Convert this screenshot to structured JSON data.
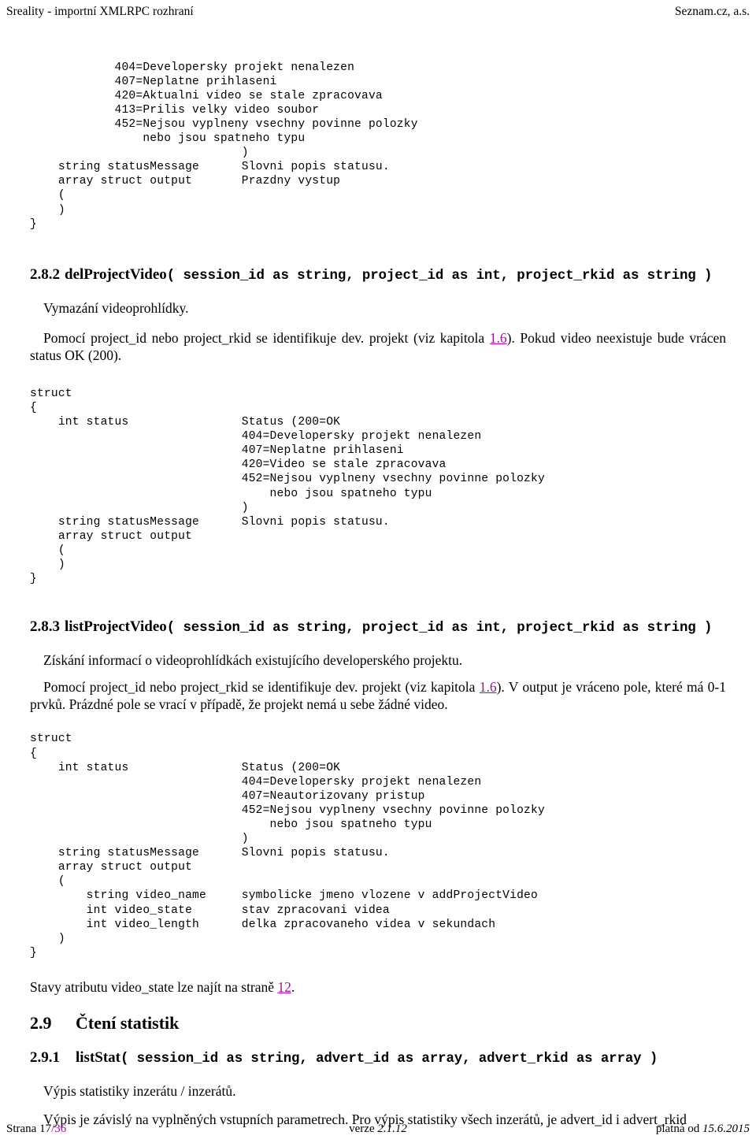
{
  "header": {
    "left": "Sreality - importní XMLRPC rozhraní",
    "right": "Seznam.cz, a.s."
  },
  "footer": {
    "page_label": "Strana ",
    "page_current": "17",
    "page_total": "/36",
    "version_label": "verze ",
    "version_value": "2.1.12",
    "valid_label": "platná od ",
    "valid_value": "15.6.2015"
  },
  "blocks": {
    "top_struct_tail": "            404=Developersky projekt nenalezen\n            407=Neplatne prihlaseni\n            420=Aktualni video se stale zpracovava\n            413=Prilis velky video soubor\n            452=Nejsou vyplneny vsechny povinne polozky\n                nebo jsou spatneho typu\n                              )\n    string statusMessage      Slovni popis statusu.\n    array struct output       Prazdny vystup\n    (\n    )\n}",
    "del_struct": "struct\n{\n    int status                Status (200=OK\n                              404=Developersky projekt nenalezen\n                              407=Neplatne prihlaseni\n                              420=Video se stale zpracovava\n                              452=Nejsou vyplneny vsechny povinne polozky\n                                  nebo jsou spatneho typu\n                              )\n    string statusMessage      Slovni popis statusu.\n    array struct output\n    (\n    )\n}",
    "list_struct": "struct\n{\n    int status                Status (200=OK\n                              404=Developersky projekt nenalezen\n                              407=Neautorizovany pristup\n                              452=Nejsou vyplneny vsechny povinne polozky\n                                  nebo jsou spatneho typu\n                              )\n    string statusMessage      Slovni popis statusu.\n    array struct output\n    (\n        string video_name     symbolicke jmeno vlozene v addProjectVideo\n        int video_state       stav zpracovani videa\n        int video_length      delka zpracovaneho videa v sekundach\n    )\n}"
  },
  "sections": {
    "del_project_video": {
      "number": "2.8.2",
      "name": "delProjectVideo",
      "signature": "( session_id as string, project_id as int, project_rkid as string )",
      "para1": "Vymazání videoprohlídky.",
      "para2_a": "Pomocí project_id nebo project_rkid se identifikuje dev. projekt (viz kapitola ",
      "para2_link": "1.6",
      "para2_b": "). Pokud video neexistuje bude vrácen status OK (200)."
    },
    "list_project_video": {
      "number": "2.8.3",
      "name": "listProjectVideo",
      "signature": "( session_id as string, project_id as int, project_rkid as string )",
      "para1": "Získání informací o videoprohlídkách existujícího developerského projektu.",
      "para2_a": "Pomocí project_id nebo project_rkid se identifikuje dev. projekt (viz kapitola ",
      "para2_link": "1.6",
      "para2_b": "). V output je vráceno pole, které má 0-1 prvků. Prázdné pole se vrací v případě, že projekt nemá u sebe žádné video.",
      "note_a": "Stavy atributu video_state lze najít na straně ",
      "note_link": "12",
      "note_b": "."
    },
    "cteni_statistik": {
      "number": "2.9",
      "title": "Čtení statistik"
    },
    "list_stat": {
      "number": "2.9.1",
      "name": "listStat",
      "signature": "( session_id as string, advert_id as array, advert_rkid as array )",
      "para1": "Výpis statistiky inzerátu / inzerátů.",
      "para2": "Výpis je závislý na vyplněných vstupních parametrech. Pro výpis statistiky všech inzerátů, je advert_id i advert_rkid"
    }
  }
}
